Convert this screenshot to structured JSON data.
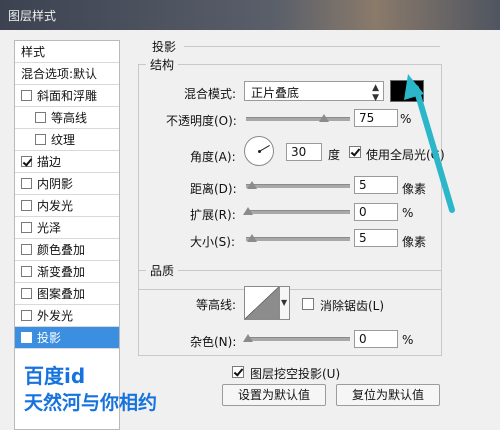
{
  "window": {
    "title": "图层样式"
  },
  "left_panel": {
    "items": [
      {
        "label": "样式",
        "checkbox": false,
        "checked": false,
        "indent": 0,
        "selected": false
      },
      {
        "label": "混合选项:默认",
        "checkbox": false,
        "checked": false,
        "indent": 0,
        "selected": false
      },
      {
        "label": "斜面和浮雕",
        "checkbox": true,
        "checked": false,
        "indent": 0,
        "selected": false
      },
      {
        "label": "等高线",
        "checkbox": true,
        "checked": false,
        "indent": 1,
        "selected": false
      },
      {
        "label": "纹理",
        "checkbox": true,
        "checked": false,
        "indent": 1,
        "selected": false
      },
      {
        "label": "描边",
        "checkbox": true,
        "checked": true,
        "indent": 0,
        "selected": false
      },
      {
        "label": "内阴影",
        "checkbox": true,
        "checked": false,
        "indent": 0,
        "selected": false
      },
      {
        "label": "内发光",
        "checkbox": true,
        "checked": false,
        "indent": 0,
        "selected": false
      },
      {
        "label": "光泽",
        "checkbox": true,
        "checked": false,
        "indent": 0,
        "selected": false
      },
      {
        "label": "颜色叠加",
        "checkbox": true,
        "checked": false,
        "indent": 0,
        "selected": false
      },
      {
        "label": "渐变叠加",
        "checkbox": true,
        "checked": false,
        "indent": 0,
        "selected": false
      },
      {
        "label": "图案叠加",
        "checkbox": true,
        "checked": false,
        "indent": 0,
        "selected": false
      },
      {
        "label": "外发光",
        "checkbox": true,
        "checked": false,
        "indent": 0,
        "selected": false
      },
      {
        "label": "投影",
        "checkbox": true,
        "checked": true,
        "indent": 0,
        "selected": true
      }
    ]
  },
  "watermark": {
    "line1": "百度id",
    "line2": "天然河与你相约"
  },
  "drop_shadow": {
    "section_title": "投影",
    "structure": {
      "group_title": "结构",
      "blend_mode_label": "混合模式:",
      "blend_mode_value": "正片叠底",
      "shadow_color": "#000000",
      "opacity_label": "不透明度(O):",
      "opacity_value": "75",
      "opacity_unit": "%",
      "opacity_fraction": 0.75,
      "angle_label": "角度(A):",
      "angle_value": "30",
      "angle_unit": "度",
      "global_light_label": "使用全局光(G)",
      "global_light_checked": true,
      "distance_label": "距离(D):",
      "distance_value": "5",
      "distance_unit": "像素",
      "spread_label": "扩展(R):",
      "spread_value": "0",
      "spread_unit": "%",
      "size_label": "大小(S):",
      "size_value": "5",
      "size_unit": "像素"
    },
    "quality": {
      "group_title": "品质",
      "contour_label": "等高线:",
      "antialias_label": "消除锯齿(L)",
      "antialias_checked": false,
      "noise_label": "杂色(N):",
      "noise_value": "0",
      "noise_unit": "%"
    },
    "knockout_label": "图层挖空投影(U)",
    "knockout_checked": true,
    "set_default_button": "设置为默认值",
    "reset_default_button": "复位为默认值"
  },
  "colors": {
    "accent": "#3c8ee0",
    "annotation_arrow": "#2bb7c9",
    "watermark": "#1673de"
  }
}
